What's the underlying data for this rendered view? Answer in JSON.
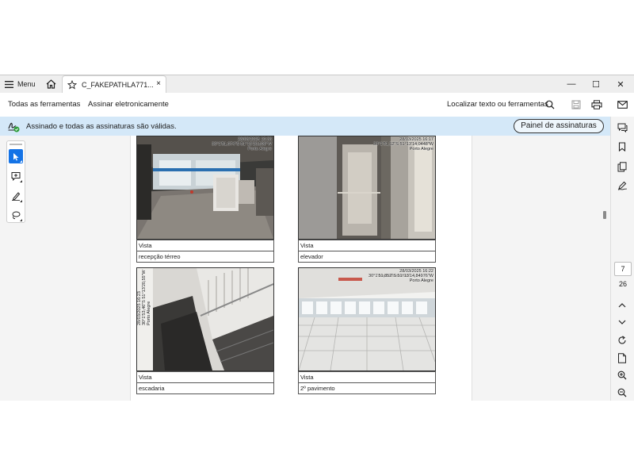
{
  "titlebar": {
    "menu_label": "Menu",
    "tab_title": "C_FAKEPATHLA771...",
    "tab_close": "×",
    "window_controls": [
      "—",
      "☐",
      "✕"
    ]
  },
  "toolbar": {
    "all_tools": "Todas as ferramentas",
    "sign": "Assinar eletronicamente",
    "search_label": "Localizar texto ou ferramentas"
  },
  "banner": {
    "message": "Assinado e todas as assinaturas são válidas.",
    "button": "Painel de assinaturas"
  },
  "photos": [
    {
      "stamp": [
        "28/03/2025 16:36",
        "30°1'51,674\"S 51°13'20,598\"W",
        "Porto Alegre"
      ],
      "label1": "Vista",
      "label2": "recepção térreo"
    },
    {
      "stamp": [
        "28/03/2025 16:17",
        "30°1'51,52\"S 51°13'14,0448\"W",
        "Porto Alegre"
      ],
      "label1": "Vista",
      "label2": "elevador"
    },
    {
      "stamp": [
        "28/03/2025 16:23",
        "30°1'53,46\"S 51°13'20,55\"W",
        "Porto Alegre"
      ],
      "label1": "Vista",
      "label2": "escadaria"
    },
    {
      "stamp": [
        "28/03/2025 16:22",
        "30°1'51,852\"S 51°13'14,84976\"W",
        "Porto Alegre"
      ],
      "label1": "Vista",
      "label2": "2º pavimento"
    }
  ],
  "pagination": {
    "current": "7",
    "total": "26"
  },
  "colors": {
    "accent": "#1473e6",
    "banner": "#d4e8f8"
  }
}
